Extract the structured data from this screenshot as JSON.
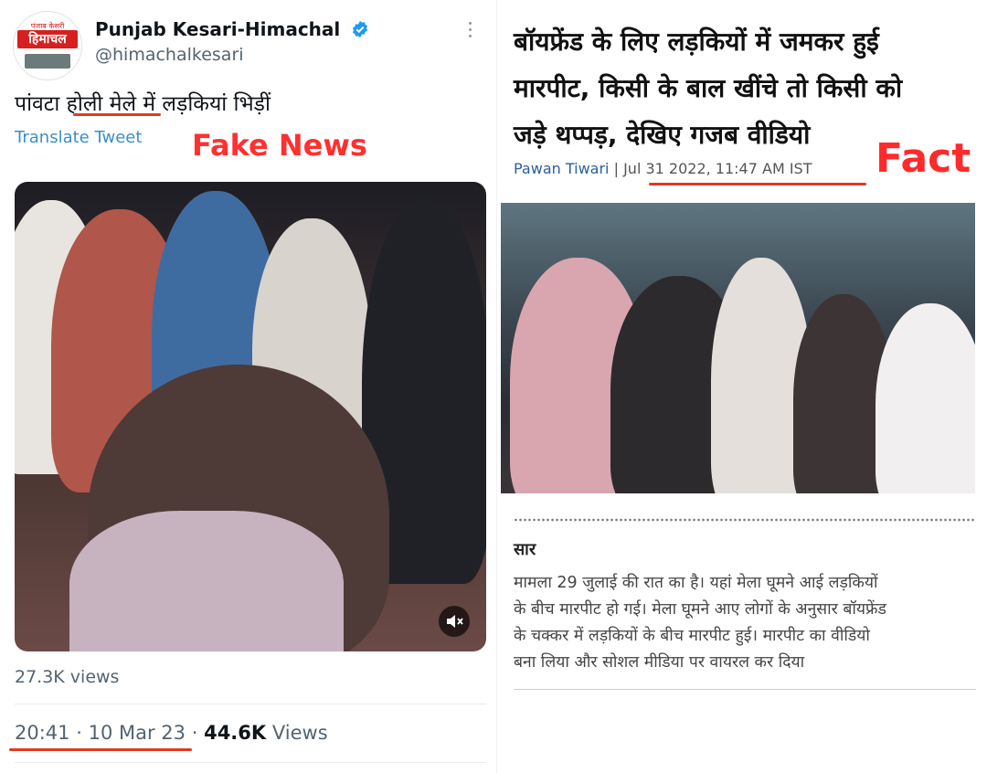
{
  "tweet": {
    "avatar": {
      "logo_top": "पंजाब केसरी",
      "logo_main": "हिमाचल"
    },
    "name": "Punjab Kesari-Himachal",
    "handle": "@himachalkesari",
    "text": "पांवटा होली मेले में लड़कियां भिड़ीं",
    "translate_label": "Translate Tweet",
    "overlay_label": "Fake News",
    "views_count": "27.3K views",
    "time": "20:41",
    "date": "10 Mar 23",
    "total_views_number": "44.6K",
    "total_views_word": "Views",
    "separator": "·",
    "accent_color": "#1d9bf0",
    "underline_color": "#e03a1e"
  },
  "article": {
    "headline_lines": [
      "बॉयफ्रेंड के लिए लड़कियों में जमकर हुई",
      "मारपीट, किसी के बाल खींचे तो किसी को",
      "जड़े थप्पड़, देखिए गजब वीडियो"
    ],
    "author": "Pawan Tiwari",
    "separator": "|",
    "published": "Jul 31 2022, 11:47 AM IST",
    "overlay_label": "Fact",
    "summary_heading": "सार",
    "summary_lines": [
      "मामला 29 जुलाई की  रात का है। यहां मेला घूमने आई लड़कियों",
      "के बीच मारपीट हो गई। मेला घूमने आए लोगों के अनुसार बॉयफ्रेंड",
      "के चक्कर में लड़कियों के बीच मारपीट हुई।  मारपीट का वीडियो",
      "बना लिया और  सोशल मीडिया पर वायरल कर दिया"
    ]
  }
}
